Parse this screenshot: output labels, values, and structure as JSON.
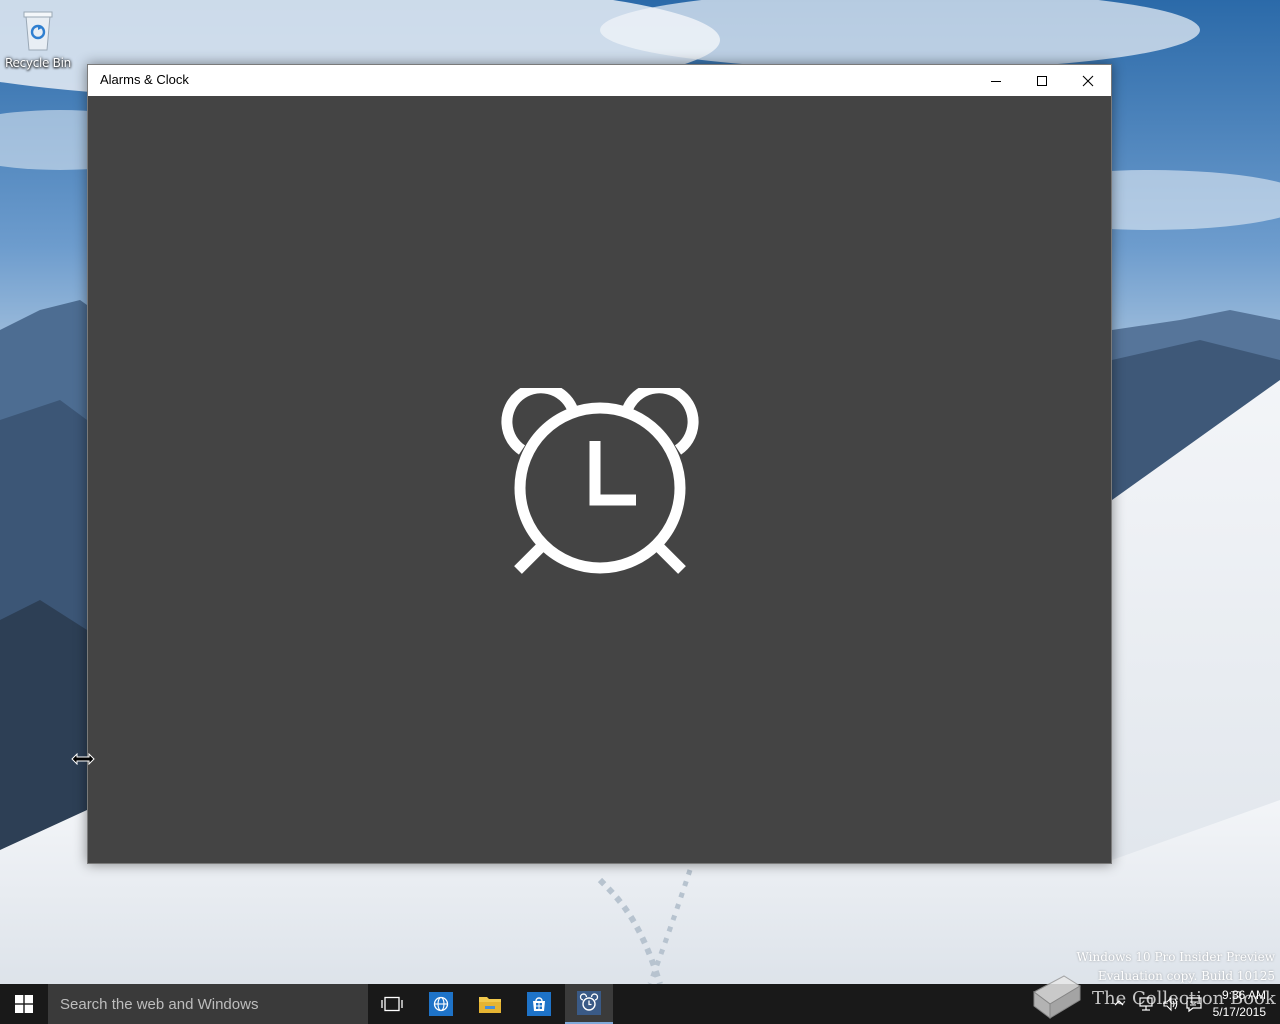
{
  "desktop": {
    "icons": [
      {
        "label": "Recycle Bin",
        "icon": "recycle-bin-icon"
      }
    ],
    "watermark": {
      "line1": "Windows 10 Pro Insider Preview",
      "line2": "Evaluation copy. Build 10125"
    },
    "overlay_logo_text": "The Collection Book"
  },
  "window": {
    "title": "Alarms & Clock",
    "controls": [
      "minimize-icon",
      "maximize-icon",
      "close-icon"
    ],
    "content_background": "#444444",
    "splash_icon": "alarm-clock-icon"
  },
  "taskbar": {
    "search_placeholder": "Search the web and Windows",
    "pinned": [
      {
        "name": "task-view-icon"
      },
      {
        "name": "edge-icon",
        "color": "#1e73c8"
      },
      {
        "name": "file-explorer-icon",
        "color": "#f2c94c"
      },
      {
        "name": "store-icon",
        "color": "#1e73c8"
      },
      {
        "name": "alarms-clock-icon",
        "active": true
      }
    ],
    "tray": {
      "time": "9:36 AM",
      "date": "5/17/2015"
    }
  },
  "colors": {
    "accent": "#7fa9d9",
    "taskbar": "#101010",
    "title_bar": "#ffffff"
  }
}
